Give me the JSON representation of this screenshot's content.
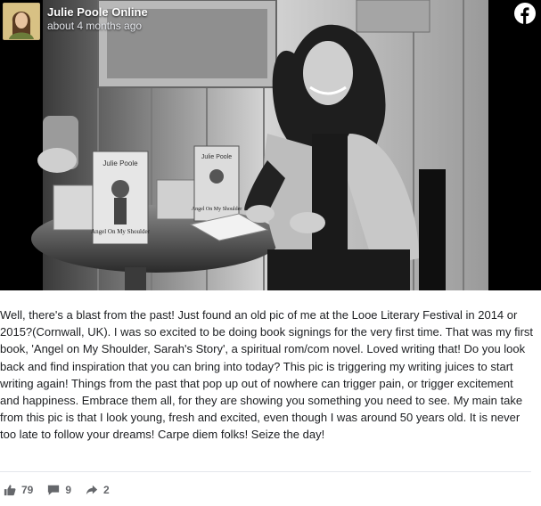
{
  "post": {
    "author_name": "Julie Poole Online",
    "timestamp": "about 4 months ago",
    "platform_icon": "facebook-icon",
    "photo": {
      "description_icon": "photo",
      "book_cover_author": "Julie Poole",
      "book_cover_title": "Angel On My Shoulder",
      "book_cover_author_2": "Julie Poole",
      "book_cover_title_2": "Angel On My Shoulder"
    },
    "caption": "Well, there's a blast from the past! Just found an old pic of me at the Looe Literary Festival in 2014 or 2015?(Cornwall, UK). I was so excited to be doing book signings for the very first time. That was my first book, 'Angel on My Shoulder, Sarah's Story', a spiritual rom/com novel. Loved writing that! Do you look back and find inspiration that you can bring into today? This pic is triggering my writing juices to start writing again! Things from the past that pop up out of nowhere can trigger pain, or trigger excitement and happiness. Embrace them all, for they are showing you something you need to see. My main take from this pic is that I look young, fresh and excited, even though I was around 50 years old. It is never too late to follow your dreams! Carpe diem folks! Seize the day!",
    "stats": {
      "likes": "79",
      "comments": "9",
      "shares": "2"
    },
    "colors": {
      "text": "#1c1e21",
      "muted": "#65676b",
      "divider": "#e4e6eb"
    }
  }
}
